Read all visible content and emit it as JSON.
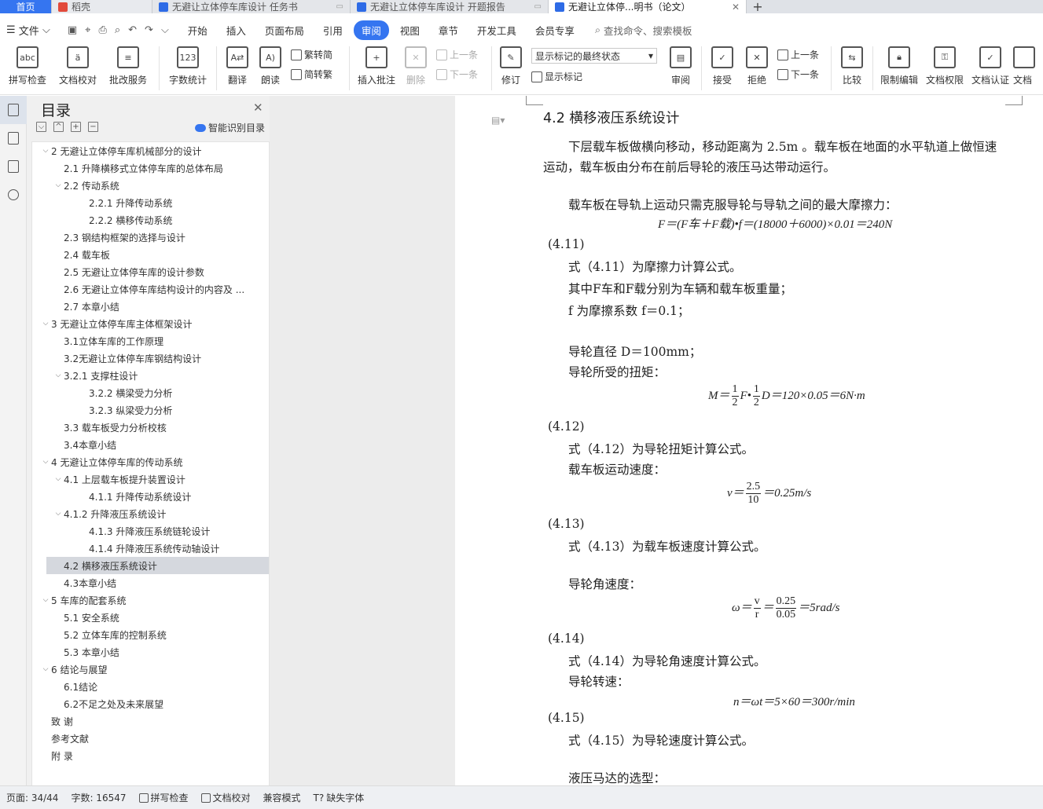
{
  "tabs": [
    {
      "label": "首页",
      "kind": "home"
    },
    {
      "label": "稻壳",
      "kind": "daoke"
    },
    {
      "label": "无避让立体停车库设计 任务书",
      "kind": "doc"
    },
    {
      "label": "无避让立体停车库设计 开题报告",
      "kind": "doc"
    },
    {
      "label": "无避让立体停...明书（论文）",
      "kind": "doc",
      "active": true
    }
  ],
  "menubar": {
    "file": "文件",
    "items": [
      "开始",
      "插入",
      "页面布局",
      "引用",
      "审阅",
      "视图",
      "章节",
      "开发工具",
      "会员专享"
    ],
    "active": "审阅",
    "search": "查找命令、搜索模板"
  },
  "ribbon": {
    "spell_check": "拼写检查",
    "doc_proof": "文档校对",
    "annotate_service": "批改服务",
    "word_count": "字数统计",
    "translate": "翻译",
    "read_aloud": "朗读",
    "trad_to_simp": "繁转简",
    "simp_to_trad": "简转繁",
    "insert_comment": "插入批注",
    "delete": "删除",
    "prev_comment": "上一条",
    "next_comment": "下一条",
    "revise": "修订",
    "markup_select": "显示标记的最终状态",
    "show_markup": "显示标记",
    "review": "审阅",
    "accept": "接受",
    "reject": "拒绝",
    "prev": "上一条",
    "next": "下一条",
    "compare": "比较",
    "restrict_edit": "限制编辑",
    "doc_permission": "文档权限",
    "doc_cert": "文档认证",
    "doc_more": "文档"
  },
  "toc": {
    "title": "目录",
    "ai_label": "智能识别目录",
    "items": [
      {
        "text": "2  无避让立体停车库机械部分的设计",
        "level": 1,
        "arrow": "v"
      },
      {
        "text": "2.1  升降横移式立体停车库的总体布局",
        "level": 2
      },
      {
        "text": "2.2  传动系统",
        "level": 2,
        "arrow": "v"
      },
      {
        "text": "2.2.1  升降传动系统",
        "level": 3
      },
      {
        "text": "2.2.2  横移传动系统",
        "level": 3
      },
      {
        "text": "2.3  钢结构框架的选择与设计",
        "level": 2
      },
      {
        "text": "2.4  载车板",
        "level": 2
      },
      {
        "text": "2.5  无避让立体停车库的设计参数",
        "level": 2
      },
      {
        "text": "2.6  无避让立体停车库结构设计的内容及 ...",
        "level": 2
      },
      {
        "text": "2.7  本章小结",
        "level": 2
      },
      {
        "text": "3  无避让立体停车库主体框架设计",
        "level": 1,
        "arrow": "v"
      },
      {
        "text": "3.1立体车库的工作原理",
        "level": 2
      },
      {
        "text": "3.2无避让立体停车库钢结构设计",
        "level": 2
      },
      {
        "text": "3.2.1  支撑柱设计",
        "level": 2,
        "arrow": "v"
      },
      {
        "text": "3.2.2  横梁受力分析",
        "level": 3
      },
      {
        "text": "3.2.3  纵梁受力分析",
        "level": 3
      },
      {
        "text": "3.3  载车板受力分析校核",
        "level": 2
      },
      {
        "text": "3.4本章小结",
        "level": 2
      },
      {
        "text": "4  无避让立体停车库的传动系统",
        "level": 1,
        "arrow": "v"
      },
      {
        "text": "4.1  上层载车板提升装置设计",
        "level": 2,
        "arrow": "v"
      },
      {
        "text": "4.1.1  升降传动系统设计",
        "level": 3
      },
      {
        "text": "4.1.2  升降液压系统设计",
        "level": 2,
        "arrow": "v"
      },
      {
        "text": "4.1.3  升降液压系统链轮设计",
        "level": 3
      },
      {
        "text": "4.1.4  升降液压系统传动轴设计",
        "level": 3
      },
      {
        "text": "4.2  横移液压系统设计",
        "level": 2,
        "selected": true
      },
      {
        "text": "4.3本章小结",
        "level": 2
      },
      {
        "text": "5  车库的配套系统",
        "level": 1,
        "arrow": "v"
      },
      {
        "text": "5.1  安全系统",
        "level": 2
      },
      {
        "text": "5.2  立体车库的控制系统",
        "level": 2
      },
      {
        "text": "5.3  本章小结",
        "level": 2
      },
      {
        "text": "6  结论与展望",
        "level": 1,
        "arrow": "v"
      },
      {
        "text": "6.1结论",
        "level": 2
      },
      {
        "text": "6.2不足之处及未来展望",
        "level": 2
      },
      {
        "text": "致    谢",
        "level": 1
      },
      {
        "text": "参考文献",
        "level": 1
      },
      {
        "text": "附    录",
        "level": 1
      }
    ]
  },
  "doc": {
    "heading": "4.2  横移液压系统设计",
    "para1_line1": "下层载车板做横向移动，移动距离为 2.5m 。载车板在地面的水平轨道上做恒速",
    "para1_line2": "运动，载车板由分布在前后导轮的液压马达带动运行。",
    "para2": "载车板在导轨上运动只需克服导轮与导轨之间的最大摩擦力：",
    "eq1": "F＝(F车＋F载)•f＝(18000＋6000)×0.01＝240N",
    "eq1_no": "(4.11)",
    "eq1_desc": "式（4.11）为摩擦力计算公式。",
    "eq1_where": "其中F车和F载分别为车辆和载车板重量；",
    "f_desc": "f 为摩擦系数 f＝0.1；",
    "wheel_dia": "导轮直径 D＝100mm；",
    "torque_intro": "导轮所受的扭矩：",
    "eq2_lhs": "M＝",
    "eq2_half1_num": "1",
    "eq2_half1_den": "2",
    "eq2_mid": "F•",
    "eq2_half2_num": "1",
    "eq2_half2_den": "2",
    "eq2_rhs": "D＝120×0.05＝6N·m",
    "eq2_no": "(4.12)",
    "eq2_desc": "式（4.12）为导轮扭矩计算公式。",
    "speed_intro": "载车板运动速度：",
    "eq3_lhs": "v＝",
    "eq3_num": "2.5",
    "eq3_den": "10",
    "eq3_rhs": "＝0.25m/s",
    "eq3_no": "(4.13)",
    "eq3_desc": "式（4.13）为载车板速度计算公式。",
    "omega_intro": "导轮角速度：",
    "eq4_lhs": "ω＝",
    "eq4_f1_num": "v",
    "eq4_f1_den": "r",
    "eq4_eq": "＝",
    "eq4_f2_num": "0.25",
    "eq4_f2_den": "0.05",
    "eq4_rhs": "＝5rad/s",
    "eq4_no": "(4.14)",
    "eq4_desc": "式（4.14）为导轮角速度计算公式。",
    "rpm_intro": "导轮转速：",
    "eq5": "n＝ωt＝5×60＝300r/min",
    "eq5_no": "(4.15)",
    "eq5_desc": "式（4.15）为导轮速度计算公式。",
    "motor_sel": "液压马达的选型："
  },
  "status": {
    "page": "页面: 34/44",
    "words": "字数: 16547",
    "spell": "拼写检查",
    "proof": "文档校对",
    "compat": "兼容模式",
    "missing_font": "缺失字体"
  },
  "colors": {
    "accent": "#3575f0",
    "selected_toc": "#d5d8de"
  }
}
